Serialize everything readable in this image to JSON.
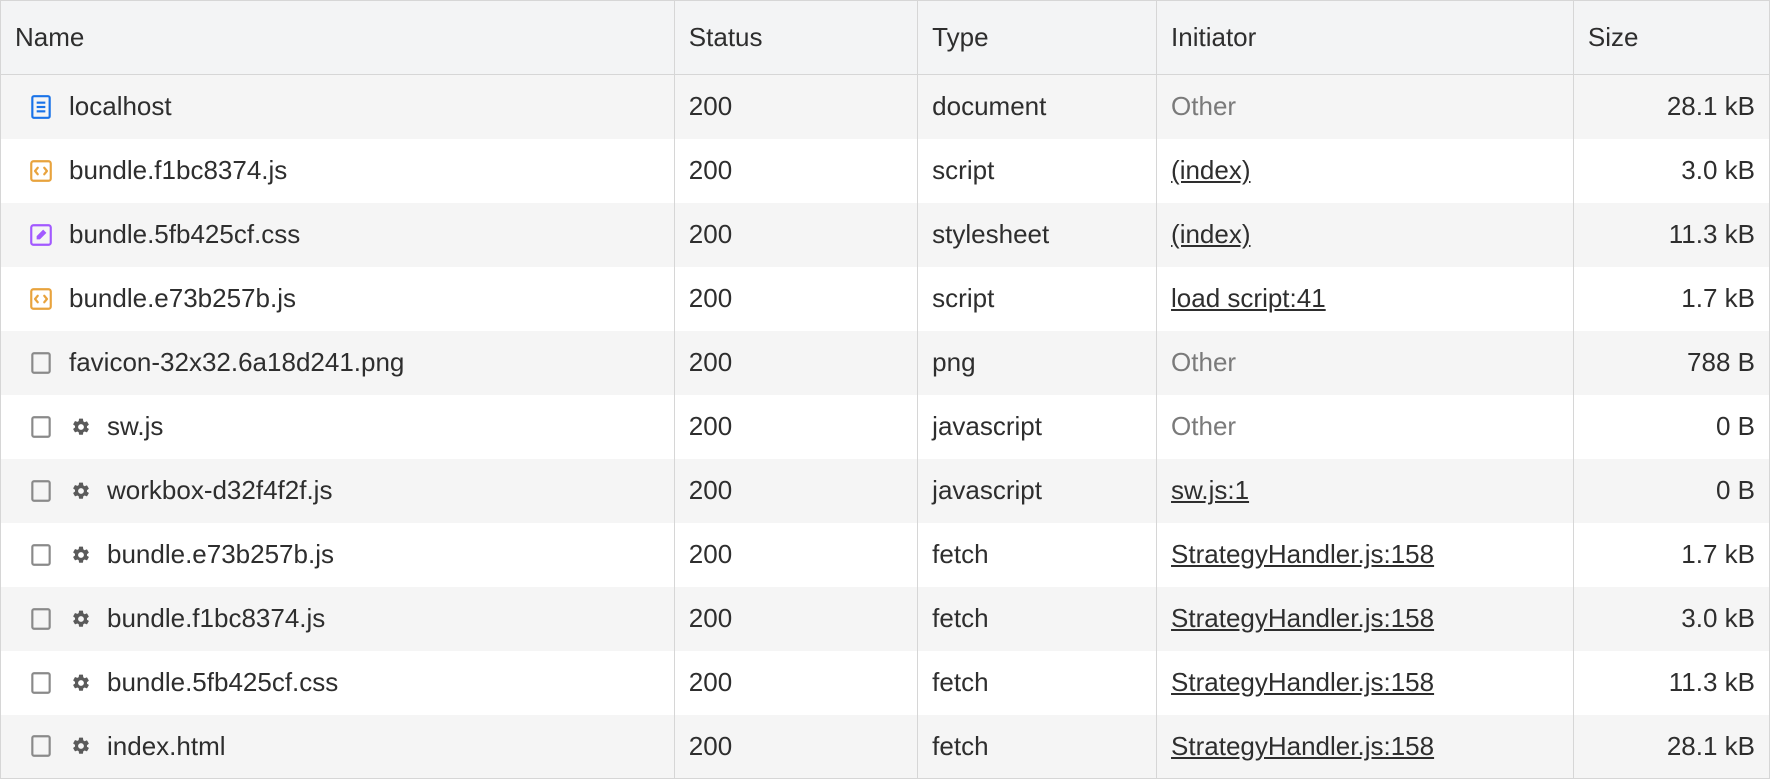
{
  "columns": {
    "name": "Name",
    "status": "Status",
    "type": "Type",
    "initiator": "Initiator",
    "size": "Size"
  },
  "rows": [
    {
      "icon": "document",
      "gear": false,
      "name": "localhost",
      "status": "200",
      "type": "document",
      "initiator": "Other",
      "initiator_link": false,
      "size": "28.1 kB"
    },
    {
      "icon": "script",
      "gear": false,
      "name": "bundle.f1bc8374.js",
      "status": "200",
      "type": "script",
      "initiator": "(index)",
      "initiator_link": true,
      "size": "3.0 kB"
    },
    {
      "icon": "style",
      "gear": false,
      "name": "bundle.5fb425cf.css",
      "status": "200",
      "type": "stylesheet",
      "initiator": "(index)",
      "initiator_link": true,
      "size": "11.3 kB"
    },
    {
      "icon": "script",
      "gear": false,
      "name": "bundle.e73b257b.js",
      "status": "200",
      "type": "script",
      "initiator": "load script:41",
      "initiator_link": true,
      "size": "1.7 kB"
    },
    {
      "icon": "blank",
      "gear": false,
      "name": "favicon-32x32.6a18d241.png",
      "status": "200",
      "type": "png",
      "initiator": "Other",
      "initiator_link": false,
      "size": "788 B"
    },
    {
      "icon": "blank",
      "gear": true,
      "name": "sw.js",
      "status": "200",
      "type": "javascript",
      "initiator": "Other",
      "initiator_link": false,
      "size": "0 B"
    },
    {
      "icon": "blank",
      "gear": true,
      "name": "workbox-d32f4f2f.js",
      "status": "200",
      "type": "javascript",
      "initiator": "sw.js:1",
      "initiator_link": true,
      "size": "0 B"
    },
    {
      "icon": "blank",
      "gear": true,
      "name": "bundle.e73b257b.js",
      "status": "200",
      "type": "fetch",
      "initiator": "StrategyHandler.js:158",
      "initiator_link": true,
      "size": "1.7 kB"
    },
    {
      "icon": "blank",
      "gear": true,
      "name": "bundle.f1bc8374.js",
      "status": "200",
      "type": "fetch",
      "initiator": "StrategyHandler.js:158",
      "initiator_link": true,
      "size": "3.0 kB"
    },
    {
      "icon": "blank",
      "gear": true,
      "name": "bundle.5fb425cf.css",
      "status": "200",
      "type": "fetch",
      "initiator": "StrategyHandler.js:158",
      "initiator_link": true,
      "size": "11.3 kB"
    },
    {
      "icon": "blank",
      "gear": true,
      "name": "index.html",
      "status": "200",
      "type": "fetch",
      "initiator": "StrategyHandler.js:158",
      "initiator_link": true,
      "size": "28.1 kB"
    }
  ]
}
